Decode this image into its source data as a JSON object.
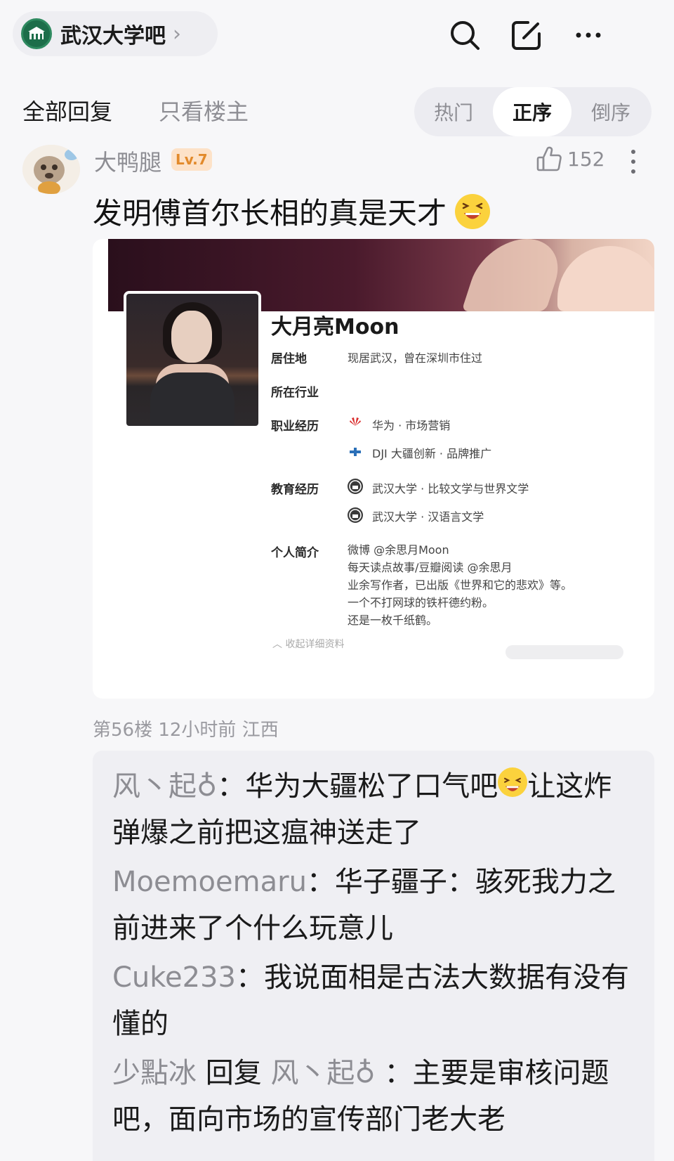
{
  "topbar": {
    "forum_name": "武汉大学吧",
    "chevron": "›",
    "icons": [
      "search-icon",
      "edit-icon",
      "more-icon"
    ]
  },
  "tabs": {
    "all_replies": "全部回复",
    "owner_only": "只看楼主",
    "sort": [
      "热门",
      "正序",
      "倒序"
    ],
    "active_sort": "正序"
  },
  "post": {
    "username": "大鸭腿",
    "level": "Lv.7",
    "likes": "152",
    "text": "发明傅首尔长相的真是天才",
    "meta": "第56楼 12小时前 江西"
  },
  "profile_card": {
    "name": "大月亮Moon",
    "labels": {
      "residence": "居住地",
      "industry": "所在行业",
      "career": "职业经历",
      "education": "教育经历",
      "bio": "个人简介"
    },
    "residence": "现居武汉，曾在深圳市住过",
    "career": [
      "华为 · 市场营销",
      "DJI 大疆创新 · 品牌推广"
    ],
    "education": [
      "武汉大学 · 比较文学与世界文学",
      "武汉大学 · 汉语言文学"
    ],
    "bio": [
      "微博 @余思月Moon",
      "每天读点故事/豆瓣阅读 @余思月",
      "业余写作者，已出版《世界和它的悲欢》等。",
      "一个不打网球的铁杆德约粉。",
      "还是一枚千纸鹤。"
    ],
    "collapse": "收起详细资料"
  },
  "replies": [
    {
      "name": "风丶起♁",
      "text_a": "华为大疆松了口气吧",
      "text_b": "让这炸弹爆之前把这瘟神送走了"
    },
    {
      "name": "Moemoemaru",
      "text": "华子疆子：骇死我力之前进来了个什么玩意儿"
    },
    {
      "name": "Cuke233",
      "text": "我说面相是古法大数据有没有懂的"
    },
    {
      "name": "少點冰",
      "reply_word": "回复",
      "target": "风丶起♁",
      "text": "主要是审核问题吧，面向市场的宣传部门老大老"
    }
  ]
}
